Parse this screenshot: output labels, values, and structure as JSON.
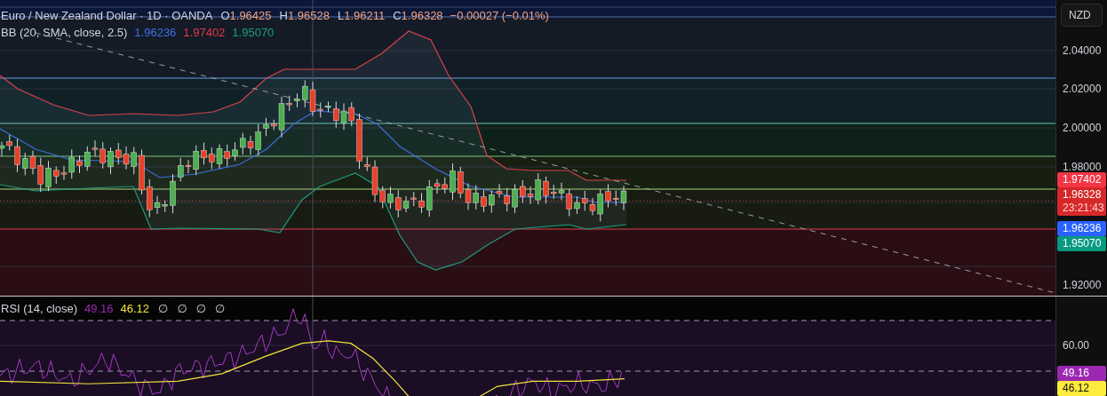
{
  "header": {
    "symbol": "Euro / New Zealand Dollar · 1D · OANDA",
    "ohlc": [
      {
        "label": "O",
        "value": "1.96425"
      },
      {
        "label": "H",
        "value": "1.96528"
      },
      {
        "label": "L",
        "value": "1.96211"
      },
      {
        "label": "C",
        "value": "1.96328"
      }
    ],
    "change": "−0.00027 (−0.01%)"
  },
  "bb_legend": {
    "name": "BB (20, SMA, close, 2.5)",
    "values": [
      {
        "text": "1.96236",
        "color": "#3f6fe8"
      },
      {
        "text": "1.97402",
        "color": "#e03a44"
      },
      {
        "text": "1.95070",
        "color": "#1f9a7f"
      }
    ]
  },
  "price_axis": {
    "currency": "NZD",
    "ticks": [
      "2.04000",
      "2.02000",
      "2.00000",
      "1.98000",
      "1.92000"
    ],
    "badges": [
      {
        "text": "1.97402",
        "color": "#f23645"
      },
      {
        "text": "1.96328",
        "sub": "23:21:43",
        "color": "#d62828"
      },
      {
        "text": "1.96236",
        "color": "#2962ff"
      },
      {
        "text": "1.95070",
        "color": "#089981"
      }
    ]
  },
  "rsi": {
    "name": "RSI (14, close)",
    "values": [
      {
        "text": "49.16",
        "color": "#9c27b0"
      },
      {
        "text": "46.12",
        "color": "#f2e33c"
      }
    ],
    "extras": [
      "∅",
      "∅",
      "∅",
      "∅"
    ],
    "axis_ticks": [
      "60.00"
    ],
    "badges": [
      {
        "text": "49.16",
        "color": "#9c27b0"
      },
      {
        "text": "46.12",
        "color": "#ffeb3b"
      }
    ]
  }
}
